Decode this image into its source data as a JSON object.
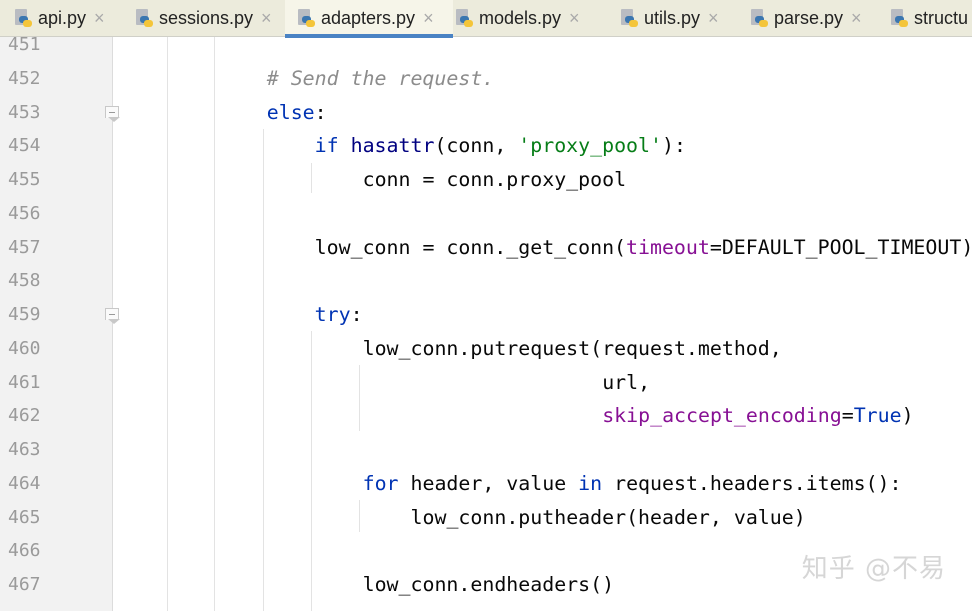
{
  "tabs": [
    {
      "label": "api.py",
      "active": false
    },
    {
      "label": "sessions.py",
      "active": false
    },
    {
      "label": "adapters.py",
      "active": true
    },
    {
      "label": "models.py",
      "active": false
    },
    {
      "label": "utils.py",
      "active": false
    },
    {
      "label": "parse.py",
      "active": false
    },
    {
      "label": "structu",
      "active": false
    }
  ],
  "close_glyph": "×",
  "colors": {
    "keyword": "#0033b3",
    "string": "#067d17",
    "kwarg": "#871094",
    "comment": "#8c8c8c",
    "active_tab_underline": "#4a83c4"
  },
  "lines": [
    {
      "num": "451",
      "indent": 0,
      "fold": false,
      "tokens": []
    },
    {
      "num": "452",
      "indent": 12,
      "fold": false,
      "tokens": [
        {
          "t": "# Send the request.",
          "c": "cmt"
        }
      ]
    },
    {
      "num": "453",
      "indent": 12,
      "fold": true,
      "tokens": [
        {
          "t": "else",
          "c": "kw"
        },
        {
          "t": ":",
          "c": ""
        }
      ]
    },
    {
      "num": "454",
      "indent": 16,
      "fold": false,
      "tokens": [
        {
          "t": "if ",
          "c": "kw"
        },
        {
          "t": "hasattr",
          "c": "bi"
        },
        {
          "t": "(conn, ",
          "c": ""
        },
        {
          "t": "'proxy_pool'",
          "c": "str"
        },
        {
          "t": "):",
          "c": ""
        }
      ]
    },
    {
      "num": "455",
      "indent": 20,
      "fold": false,
      "tokens": [
        {
          "t": "conn = conn.proxy_pool",
          "c": ""
        }
      ]
    },
    {
      "num": "456",
      "indent": 0,
      "fold": false,
      "tokens": []
    },
    {
      "num": "457",
      "indent": 16,
      "fold": false,
      "tokens": [
        {
          "t": "low_conn = conn._get_conn(",
          "c": ""
        },
        {
          "t": "timeout",
          "c": "kwarg"
        },
        {
          "t": "=DEFAULT_POOL_TIMEOUT)",
          "c": ""
        }
      ]
    },
    {
      "num": "458",
      "indent": 0,
      "fold": false,
      "tokens": []
    },
    {
      "num": "459",
      "indent": 16,
      "fold": true,
      "tokens": [
        {
          "t": "try",
          "c": "kw"
        },
        {
          "t": ":",
          "c": ""
        }
      ]
    },
    {
      "num": "460",
      "indent": 20,
      "fold": false,
      "tokens": [
        {
          "t": "low_conn.putrequest(request.method,",
          "c": ""
        }
      ]
    },
    {
      "num": "461",
      "indent": 40,
      "fold": false,
      "tokens": [
        {
          "t": "url,",
          "c": ""
        }
      ]
    },
    {
      "num": "462",
      "indent": 40,
      "fold": false,
      "tokens": [
        {
          "t": "skip_accept_encoding",
          "c": "kwarg"
        },
        {
          "t": "=",
          "c": ""
        },
        {
          "t": "True",
          "c": "kw"
        },
        {
          "t": ")",
          "c": ""
        }
      ]
    },
    {
      "num": "463",
      "indent": 0,
      "fold": false,
      "tokens": []
    },
    {
      "num": "464",
      "indent": 20,
      "fold": false,
      "tokens": [
        {
          "t": "for ",
          "c": "kw"
        },
        {
          "t": "header, value ",
          "c": ""
        },
        {
          "t": "in ",
          "c": "kw"
        },
        {
          "t": "request.headers.items():",
          "c": ""
        }
      ]
    },
    {
      "num": "465",
      "indent": 24,
      "fold": false,
      "tokens": [
        {
          "t": "low_conn.putheader(header, value)",
          "c": ""
        }
      ]
    },
    {
      "num": "466",
      "indent": 0,
      "fold": false,
      "tokens": []
    },
    {
      "num": "467",
      "indent": 20,
      "fold": false,
      "tokens": [
        {
          "t": "low_conn.endheaders()",
          "c": ""
        }
      ]
    }
  ],
  "watermark": "知乎 @不易"
}
